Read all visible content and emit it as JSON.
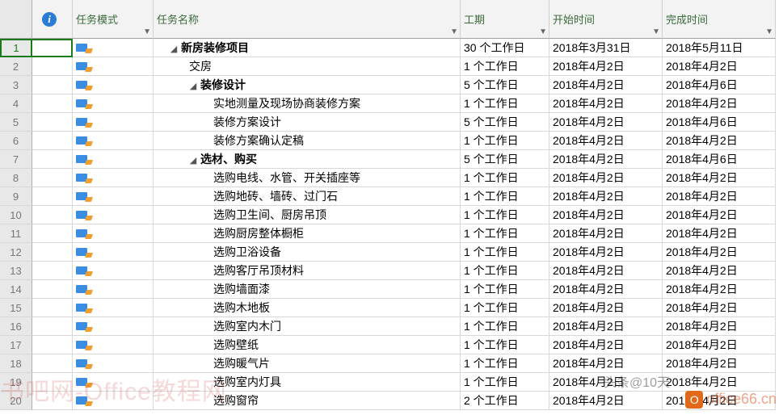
{
  "columns": {
    "info": "",
    "mode": "任务模式",
    "name": "任务名称",
    "duration": "工期",
    "start": "开始时间",
    "finish": "完成时间"
  },
  "selected_row": 1,
  "rows": [
    {
      "n": 1,
      "indent": 0,
      "summary": true,
      "name": "新房装修项目",
      "dur": "30 个工作日",
      "start": "2018年3月31日",
      "finish": "2018年5月11日"
    },
    {
      "n": 2,
      "indent": 1,
      "summary": false,
      "name": "交房",
      "dur": "1 个工作日",
      "start": "2018年4月2日",
      "finish": "2018年4月2日"
    },
    {
      "n": 3,
      "indent": 1,
      "summary": true,
      "name": "装修设计",
      "dur": "5 个工作日",
      "start": "2018年4月2日",
      "finish": "2018年4月6日"
    },
    {
      "n": 4,
      "indent": 2,
      "summary": false,
      "name": "实地测量及现场协商装修方案",
      "dur": "1 个工作日",
      "start": "2018年4月2日",
      "finish": "2018年4月2日"
    },
    {
      "n": 5,
      "indent": 2,
      "summary": false,
      "name": "装修方案设计",
      "dur": "5 个工作日",
      "start": "2018年4月2日",
      "finish": "2018年4月6日"
    },
    {
      "n": 6,
      "indent": 2,
      "summary": false,
      "name": "装修方案确认定稿",
      "dur": "1 个工作日",
      "start": "2018年4月2日",
      "finish": "2018年4月2日"
    },
    {
      "n": 7,
      "indent": 1,
      "summary": true,
      "name": "选材、购买",
      "dur": "5 个工作日",
      "start": "2018年4月2日",
      "finish": "2018年4月6日"
    },
    {
      "n": 8,
      "indent": 2,
      "summary": false,
      "name": "选购电线、水管、开关插座等",
      "dur": "1 个工作日",
      "start": "2018年4月2日",
      "finish": "2018年4月2日"
    },
    {
      "n": 9,
      "indent": 2,
      "summary": false,
      "name": "选购地砖、墙砖、过门石",
      "dur": "1 个工作日",
      "start": "2018年4月2日",
      "finish": "2018年4月2日"
    },
    {
      "n": 10,
      "indent": 2,
      "summary": false,
      "name": "选购卫生间、厨房吊顶",
      "dur": "1 个工作日",
      "start": "2018年4月2日",
      "finish": "2018年4月2日"
    },
    {
      "n": 11,
      "indent": 2,
      "summary": false,
      "name": "选购厨房整体橱柜",
      "dur": "1 个工作日",
      "start": "2018年4月2日",
      "finish": "2018年4月2日"
    },
    {
      "n": 12,
      "indent": 2,
      "summary": false,
      "name": "选购卫浴设备",
      "dur": "1 个工作日",
      "start": "2018年4月2日",
      "finish": "2018年4月2日"
    },
    {
      "n": 13,
      "indent": 2,
      "summary": false,
      "name": "选购客厅吊顶材料",
      "dur": "1 个工作日",
      "start": "2018年4月2日",
      "finish": "2018年4月2日"
    },
    {
      "n": 14,
      "indent": 2,
      "summary": false,
      "name": "选购墙面漆",
      "dur": "1 个工作日",
      "start": "2018年4月2日",
      "finish": "2018年4月2日"
    },
    {
      "n": 15,
      "indent": 2,
      "summary": false,
      "name": "选购木地板",
      "dur": "1 个工作日",
      "start": "2018年4月2日",
      "finish": "2018年4月2日"
    },
    {
      "n": 16,
      "indent": 2,
      "summary": false,
      "name": "选购室内木门",
      "dur": "1 个工作日",
      "start": "2018年4月2日",
      "finish": "2018年4月2日"
    },
    {
      "n": 17,
      "indent": 2,
      "summary": false,
      "name": "选购壁纸",
      "dur": "1 个工作日",
      "start": "2018年4月2日",
      "finish": "2018年4月2日"
    },
    {
      "n": 18,
      "indent": 2,
      "summary": false,
      "name": "选购暖气片",
      "dur": "1 个工作日",
      "start": "2018年4月2日",
      "finish": "2018年4月2日"
    },
    {
      "n": 19,
      "indent": 2,
      "summary": false,
      "name": "选购室内灯具",
      "dur": "1 个工作日",
      "start": "2018年4月2日",
      "finish": "2018年4月2日"
    },
    {
      "n": 20,
      "indent": 2,
      "summary": false,
      "name": "选购窗帘",
      "dur": "2 个工作日",
      "start": "2018年4月2日",
      "finish": "2018年4月2日"
    }
  ],
  "watermarks": {
    "main": "书吧网-Office教程网",
    "site": "office66.cn",
    "head": "头条@10天"
  }
}
